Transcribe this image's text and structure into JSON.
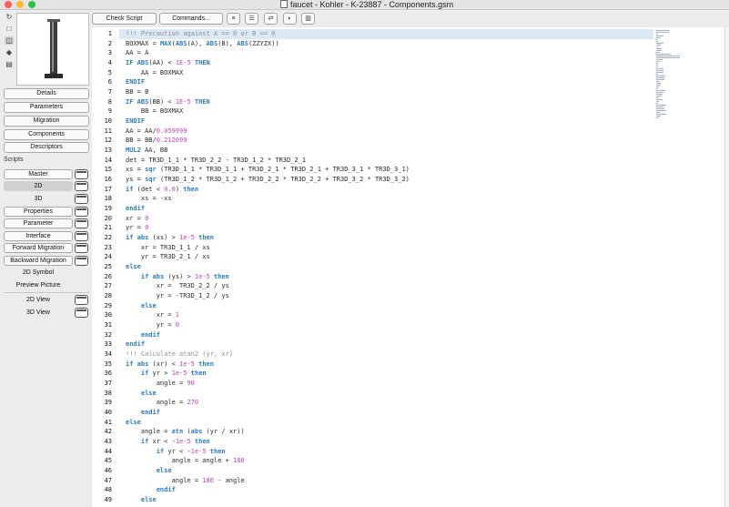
{
  "window": {
    "title": "faucet - Kohler - K-23887 - Components.gsm"
  },
  "sidebar_icons": [
    "refresh-icon",
    "square-icon",
    "camera-icon",
    "cube-icon",
    "film-icon"
  ],
  "nav": [
    "Details",
    "Parameters",
    "Migration",
    "Components",
    "Descriptors"
  ],
  "scripts_label": "Scripts",
  "scripts": [
    {
      "label": "Master",
      "window": true
    },
    {
      "label": "2D",
      "window": true,
      "selected": true
    },
    {
      "label": "3D",
      "window": true
    },
    {
      "label": "Properties",
      "window": true
    },
    {
      "label": "Parameter",
      "window": true
    },
    {
      "label": "Interface",
      "window": true
    },
    {
      "label": "Forward Migration",
      "window": true
    },
    {
      "label": "Backward Migration",
      "window": true
    },
    {
      "label": "2D Symbol",
      "window": false
    },
    {
      "label": "Preview Picture",
      "window": false
    }
  ],
  "views": [
    {
      "label": "2D View",
      "window": true
    },
    {
      "label": "3D View",
      "window": true
    }
  ],
  "toolbar": {
    "check_script": "Check Script",
    "commands": "Commands...",
    "icons": [
      "list-unordered-icon",
      "list-numbered-icon",
      "find-replace-icon",
      "toggle-icon",
      "sidebar-icon"
    ]
  },
  "editor": {
    "active_line": 1,
    "lines": [
      "!!! Precaution against A == 0 or B == 0",
      "BOXMAX = MAX(ABS(A), ABS(B), ABS(ZZYZX))",
      "AA = A",
      "IF ABS(AA) < 1E-5 THEN",
      "    AA = BOXMAX",
      "ENDIF",
      "BB = B",
      "IF ABS(BB) < 1E-5 THEN",
      "    BB = BOXMAX",
      "ENDIF",
      "AA = AA/0.059999",
      "BB = BB/0.212099",
      "MUL2 AA, BB",
      "det = TR3D_1_1 * TR3D_2_2 - TR3D_1_2 * TR3D_2_1",
      "xs = sqr (TR3D_1_1 * TR3D_1_1 + TR3D_2_1 * TR3D_2_1 + TR3D_3_1 * TR3D_3_1)",
      "ys = sqr (TR3D_1_2 * TR3D_1_2 + TR3D_2_2 * TR3D_2_2 + TR3D_3_2 * TR3D_3_2)",
      "if (det < 0.0) then",
      "    xs = -xs",
      "endif",
      "xr = 0",
      "yr = 0",
      "if abs (xs) > 1e-5 then",
      "    xr = TR3D_1_1 / xs",
      "    yr = TR3D_2_1 / xs",
      "else",
      "    if abs (ys) > 1e-5 then",
      "        xr =  TR3D_2_2 / ys",
      "        yr = -TR3D_1_2 / ys",
      "    else",
      "        xr = 1",
      "        yr = 0",
      "    endif",
      "endif",
      "!!! Calculate atan2 (yr, xr)",
      "if abs (xr) < 1e-5 then",
      "    if yr > 1e-5 then",
      "        angle = 90",
      "    else",
      "        angle = 270",
      "    endif",
      "else",
      "    angle = atn (abs (yr / xr))",
      "    if xr < -1e-5 then",
      "        if yr < -1e-5 then",
      "            angle = angle + 180",
      "        else",
      "            angle = 180 - angle",
      "        endif",
      "    else"
    ]
  }
}
